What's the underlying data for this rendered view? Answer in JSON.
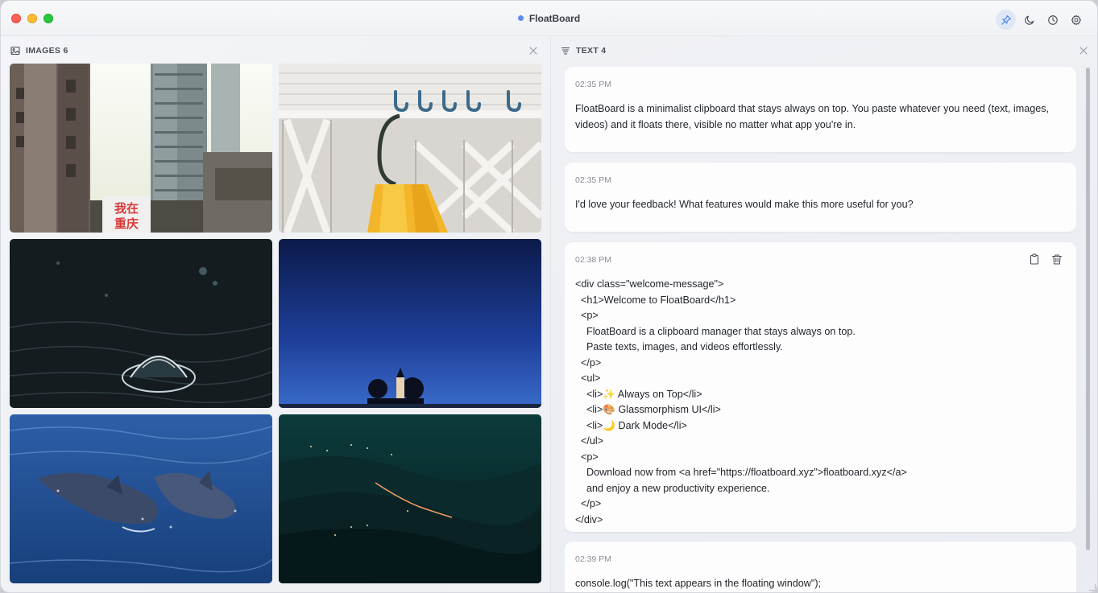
{
  "window": {
    "title": "FloatBoard",
    "toolbar": [
      "pin-icon",
      "moon-icon",
      "clock-icon",
      "gear-icon"
    ]
  },
  "images_panel": {
    "label": "IMAGES 6",
    "images": [
      {
        "name": "city-street-image",
        "sign_text": "我在\n重庆"
      },
      {
        "name": "umbrella-hooks-image"
      },
      {
        "name": "water-droplet-image"
      },
      {
        "name": "church-night-image"
      },
      {
        "name": "dolphins-image"
      },
      {
        "name": "night-valley-image"
      }
    ]
  },
  "text_panel": {
    "label": "TEXT 4",
    "items": [
      {
        "time": "02:35 PM",
        "text": "FloatBoard is a minimalist clipboard that stays always on top. You paste whatever you need (text, images, videos) and it floats there, visible no matter what app you're in."
      },
      {
        "time": "02:35 PM",
        "text": "I'd love your feedback! What features would make this more useful for you?"
      },
      {
        "time": "02:38 PM",
        "text": "<div class=\"welcome-message\">\n  <h1>Welcome to FloatBoard</h1>\n  <p>\n    FloatBoard is a clipboard manager that stays always on top.\n    Paste texts, images, and videos effortlessly.\n  </p>\n  <ul>\n    <li>✨ Always on Top</li>\n    <li>🎨 Glassmorphism UI</li>\n    <li>🌙 Dark Mode</li>\n  </ul>\n  <p>\n    Download now from <a href=\"https://floatboard.xyz\">floatboard.xyz</a>\n    and enjoy a new productivity experience.\n  </p>\n</div>"
      },
      {
        "time": "02:39 PM",
        "text": "console.log(\"This text appears in the floating window\");"
      }
    ]
  },
  "colors": {
    "accent": "#5a8dee",
    "close": "#fe5f57",
    "minimize": "#febc2e",
    "maximize": "#28c840"
  }
}
